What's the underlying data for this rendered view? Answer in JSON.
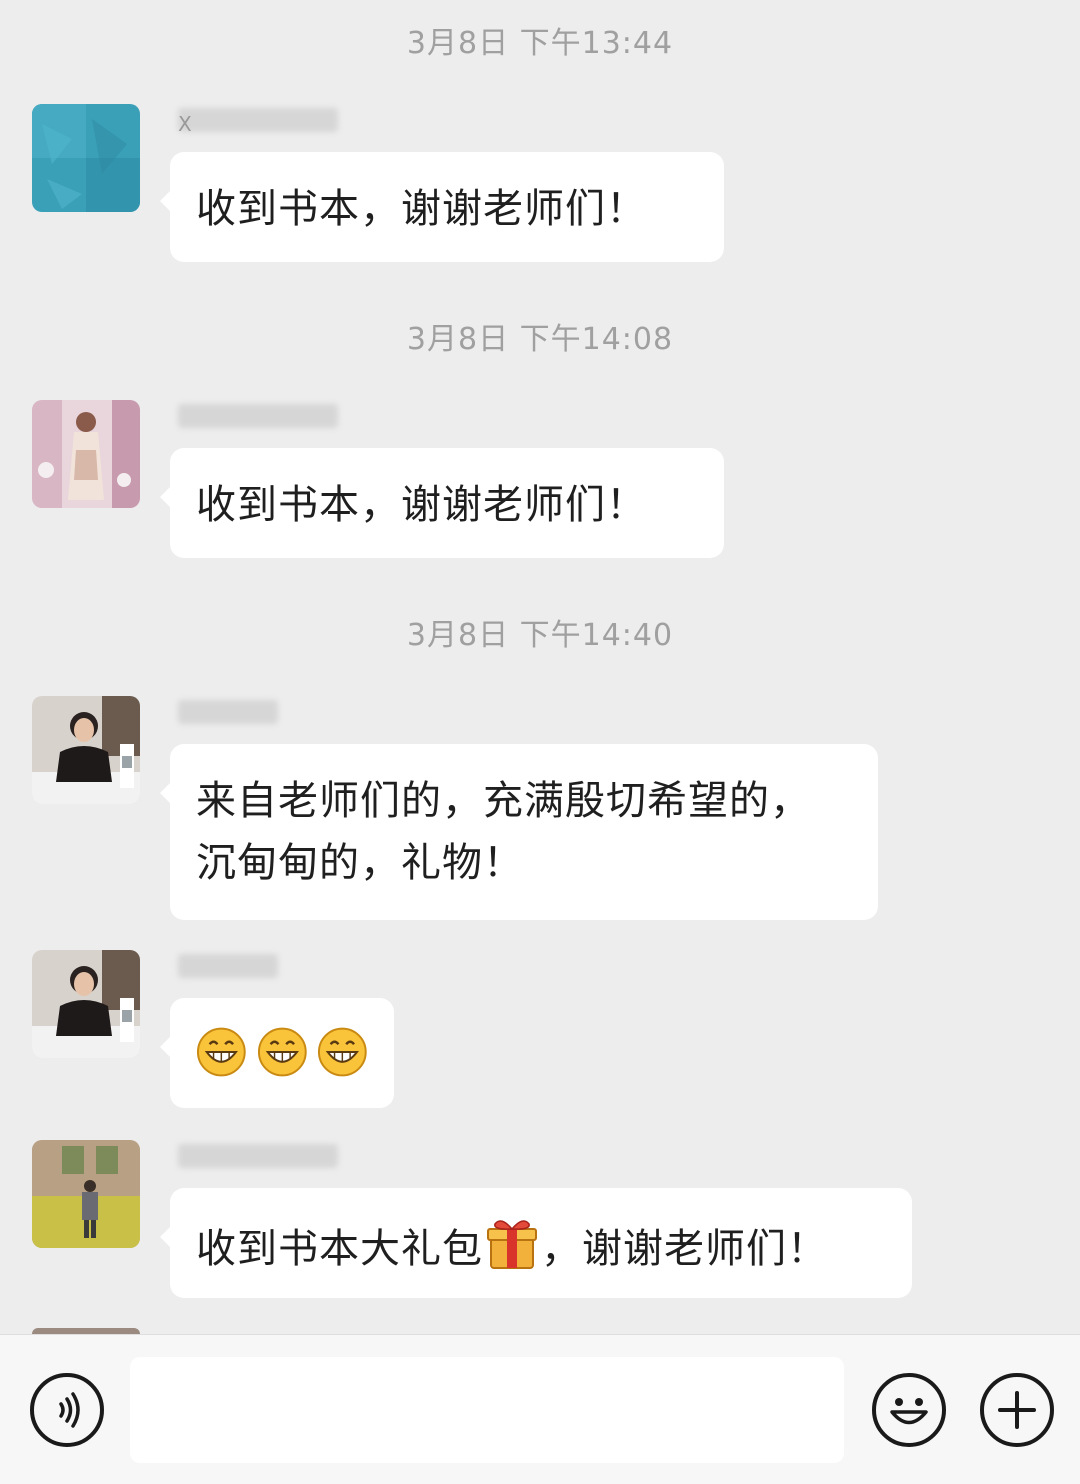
{
  "chat": {
    "timestamps": [
      "3月8日 下午13:44",
      "3月8日 下午14:08",
      "3月8日 下午14:40"
    ],
    "messages": [
      {
        "sender": "X",
        "text": "收到书本，谢谢老师们！"
      },
      {
        "sender": "",
        "text": "收到书本，谢谢老师们！"
      },
      {
        "sender": "",
        "text_line1": "来自老师们的，充满殷切希望的，",
        "text_line2": "沉甸甸的，礼物！"
      },
      {
        "sender": "",
        "emojis": [
          "grin-emoji",
          "grin-emoji",
          "grin-emoji"
        ]
      },
      {
        "sender": "",
        "text_before": "收到书本大礼包",
        "icon": "gift-icon",
        "text_after": "，谢谢老师们！"
      }
    ]
  },
  "input_bar": {
    "voice_icon": "voice-icon",
    "message_placeholder": "",
    "emoji_icon": "emoji-icon",
    "add_icon": "plus-icon"
  },
  "colors": {
    "background": "#ededed",
    "bubble": "#ffffff",
    "timestamp_text": "#a0a0a0"
  }
}
